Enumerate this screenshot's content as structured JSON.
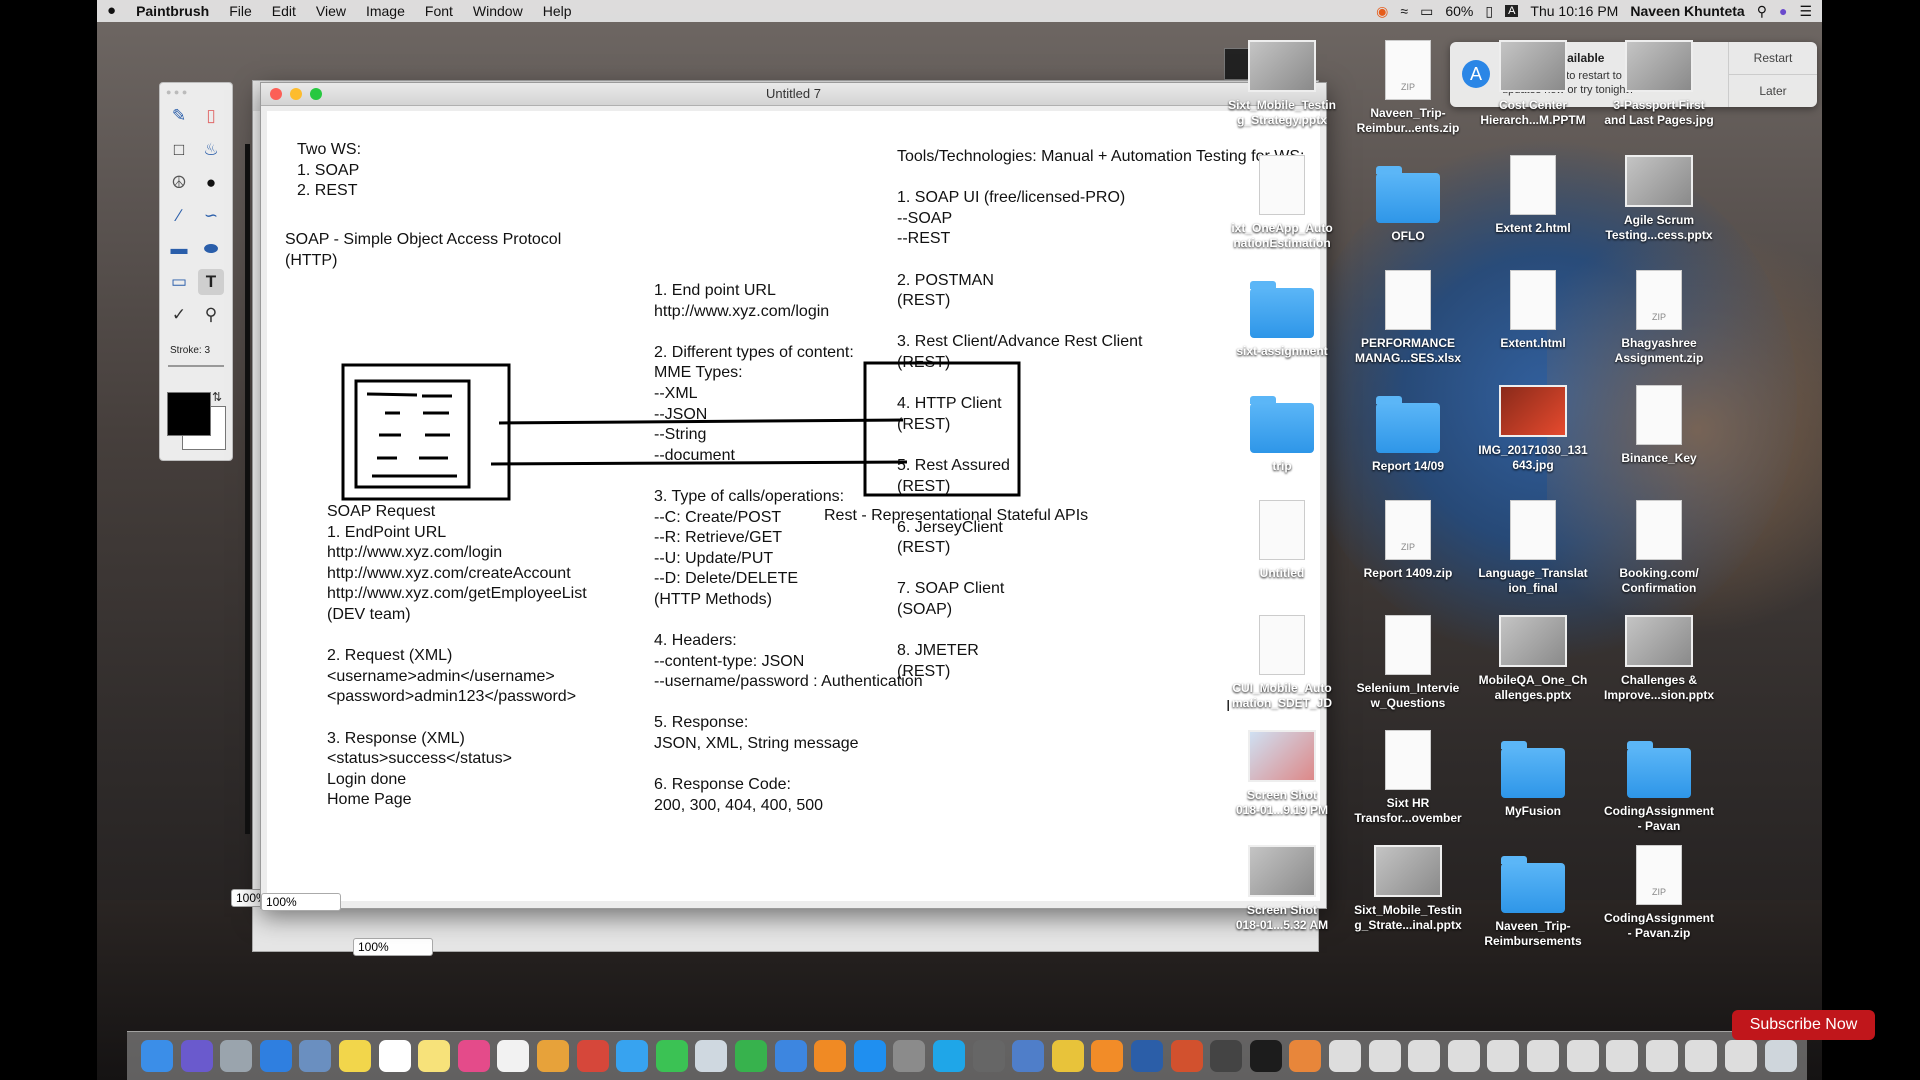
{
  "menubar": {
    "apple": "",
    "app_name": "Paintbrush",
    "items": [
      "File",
      "Edit",
      "View",
      "Image",
      "Font",
      "Window",
      "Help"
    ],
    "battery": "60%",
    "clock": "Thu 10:16 PM",
    "user": "Naveen Khunteta"
  },
  "palette": {
    "stroke_label": "Stroke: 3"
  },
  "window": {
    "title": "Untitled 7",
    "zoom_front": "100%",
    "zoom_back": "100%",
    "zoom_back_left": "100%"
  },
  "notification": {
    "title": "Updates Available",
    "body": "Do you want to restart to install these updates now or try tonight?",
    "restart": "Restart",
    "later": "Later"
  },
  "canvas": {
    "col1_top": "Two WS:\n1. SOAP\n2. REST",
    "soap_def": "SOAP - Simple Object Access Protocol\n(HTTP)",
    "soap_request": "SOAP Request\n1. EndPoint URL\nhttp://www.xyz.com/login\nhttp://www.xyz.com/createAccount\nhttp://www.xyz.com/getEmployeeList\n(DEV team)\n\n2. Request (XML)\n<username>admin</username>\n<password>admin123</password>\n\n3. Response (XML)\n<status>success</status>\nLogin done\nHome Page",
    "col2": "1. End point URL\nhttp://www.xyz.com/login\n\n2. Different types of content:\nMME Types:\n--XML\n--JSON\n--String\n--document\n\n3. Type of calls/operations:\n--C: Create/POST\n--R: Retrieve/GET\n--U: Update/PUT\n--D: Delete/DELETE\n(HTTP Methods)\n\n4. Headers:\n--content-type: JSON\n--username/password : Authentication\n\n5. Response:\nJSON, XML, String message\n\n6. Response Code:\n200, 300, 404, 400, 500",
    "rest_def": "Rest - Representational Stateful APIs",
    "col3": "Tools/Technologies: Manual + Automation Testing for WS:\n\n1. SOAP UI (free/licensed-PRO)\n--SOAP\n--REST\n\n2. POSTMAN\n(REST)\n\n3. Rest Client/Advance Rest Client\n(REST)\n\n4. HTTP Client\n(REST)\n\n5. Rest Assured\n(REST)\n\n6. JerseyClient\n(REST)\n\n7. SOAP Client\n(SOAP)\n\n8. JMETER\n(REST)"
  },
  "desktop": [
    {
      "label": "Sixt_Mobile_Testin\ng_Strategy.pptx",
      "kind": "thumb"
    },
    {
      "label": "Naveen_Trip-\nReimbur...ents.zip",
      "kind": "zip"
    },
    {
      "label": "Cost Center\nHierarch...M.PPTM",
      "kind": "thumb"
    },
    {
      "label": "3-Passport First\nand Last Pages.jpg",
      "kind": "thumb"
    },
    {
      "label": "ixt_OneApp_Auto\nnationEstimation",
      "kind": "doc"
    },
    {
      "label": "OFLO",
      "kind": "folder"
    },
    {
      "label": "Extent 2.html",
      "kind": "doc"
    },
    {
      "label": "Agile Scrum\nTesting...cess.pptx",
      "kind": "thumb"
    },
    {
      "label": "sixt-assignment",
      "kind": "folder"
    },
    {
      "label": "PERFORMANCE\nMANAG...SES.xlsx",
      "kind": "doc"
    },
    {
      "label": "Extent.html",
      "kind": "doc"
    },
    {
      "label": "Bhagyashree\nAssignment.zip",
      "kind": "zip"
    },
    {
      "label": "trip",
      "kind": "folder"
    },
    {
      "label": "Report 14/09",
      "kind": "folder"
    },
    {
      "label": "IMG_20171030_131\n643.jpg",
      "kind": "thumbred"
    },
    {
      "label": "Binance_Key",
      "kind": "doc"
    },
    {
      "label": "Untitled",
      "kind": "doc"
    },
    {
      "label": "Report 1409.zip",
      "kind": "zip"
    },
    {
      "label": "Language_Translat\nion_final",
      "kind": "doc"
    },
    {
      "label": "Booking.com/\nConfirmation",
      "kind": "doc"
    },
    {
      "label": "CUI_Mobile_Auto\nmation_SDET_JD",
      "kind": "doc"
    },
    {
      "label": "Selenium_Intervie\nw_Questions",
      "kind": "doc"
    },
    {
      "label": "MobileQA_One_Ch\nallenges.pptx",
      "kind": "thumb"
    },
    {
      "label": "Challenges &\nImprove...sion.pptx",
      "kind": "thumb"
    },
    {
      "label": "Screen Shot\n018-01...9.19 PM",
      "kind": "thumbid"
    },
    {
      "label": "Sixt HR\nTransfor...ovember",
      "kind": "doc"
    },
    {
      "label": "MyFusion",
      "kind": "folder"
    },
    {
      "label": "CodingAssignment\n- Pavan",
      "kind": "folder"
    },
    {
      "label": "Screen Shot\n018-01...5.32 AM",
      "kind": "thumb"
    },
    {
      "label": "Sixt_Mobile_Testin\ng_Strate...inal.pptx",
      "kind": "thumb"
    },
    {
      "label": "Naveen_Trip-\nReimbursements",
      "kind": "folder"
    },
    {
      "label": "CodingAssignment\n- Pavan.zip",
      "kind": "zip"
    }
  ],
  "subscribe": "Subscribe Now"
}
